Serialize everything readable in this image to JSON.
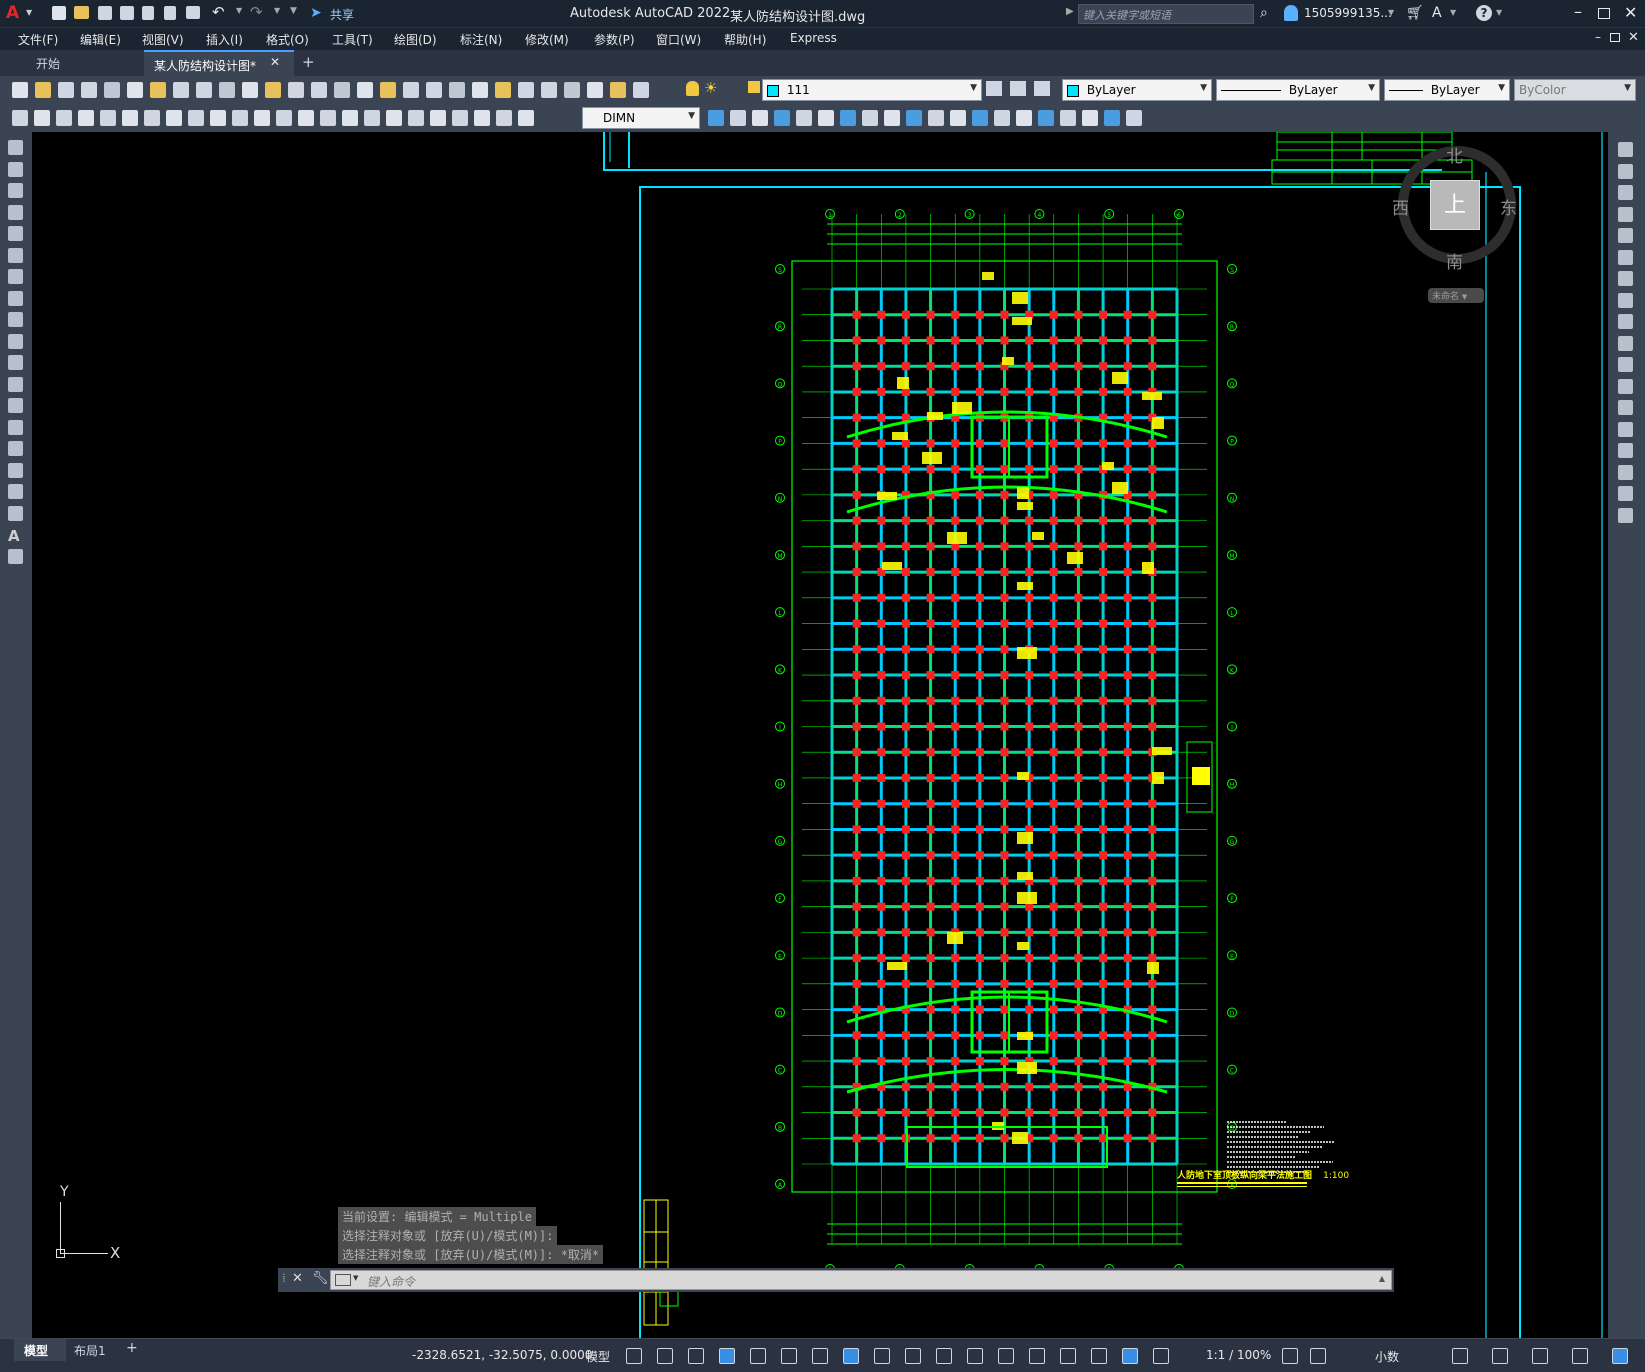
{
  "titlebar": {
    "app_title": "Autodesk AutoCAD 2022",
    "file_title": "某人防结构设计图.dwg",
    "share_label": "共享",
    "search_placeholder": "键入关键字或短语",
    "user_id": "1505999135...",
    "app_icon": "autocad-logo",
    "help_icon": "help-icon"
  },
  "menu": {
    "items": [
      "文件(F)",
      "编辑(E)",
      "视图(V)",
      "插入(I)",
      "格式(O)",
      "工具(T)",
      "绘图(D)",
      "标注(N)",
      "修改(M)",
      "参数(P)",
      "窗口(W)",
      "帮助(H)",
      "Express"
    ]
  },
  "tabs": {
    "items": [
      "开始",
      "某人防结构设计图*"
    ],
    "new_tab": "+"
  },
  "toolbar": {
    "layer_name": "111",
    "color": "ByLayer",
    "linetype": "ByLayer",
    "lineweight": "ByLayer",
    "plotstyle": "ByColor",
    "dimstyle": "DIMN"
  },
  "viewcube": {
    "north": "北",
    "south": "南",
    "east": "东",
    "west": "西",
    "top": "上",
    "wcs": "未命名"
  },
  "ucs": {
    "x": "X",
    "y": "Y"
  },
  "drawing": {
    "grid_letters_right": [
      "S",
      "R",
      "Q",
      "P",
      "N",
      "M",
      "L",
      "K",
      "J",
      "H",
      "G",
      "F",
      "E",
      "D",
      "C",
      "B",
      "A"
    ],
    "grid_numbers_top": [
      "1",
      "2",
      "3",
      "4",
      "5",
      "6"
    ],
    "title": "人防地下室顶板纵向梁平法施工图",
    "scale": "1:100",
    "colors": {
      "frame": "#00e5ff",
      "grid": "#00ff00",
      "beam": "#00c8ff",
      "column": "#ff2020",
      "text": "#ffff00"
    }
  },
  "commandline": {
    "history": [
      "当前设置: 编辑模式 = Multiple",
      "选择注释对象或 [放弃(U)/模式(M)]:",
      "选择注释对象或 [放弃(U)/模式(M)]: *取消*"
    ],
    "placeholder": "键入命令"
  },
  "status": {
    "layout_tabs": [
      "模型",
      "布局1"
    ],
    "add_layout": "+",
    "coords": "-2328.6521, -32.5075, 0.0000",
    "space": "模型",
    "scale": "1:1 / 100%",
    "units": "小数"
  }
}
